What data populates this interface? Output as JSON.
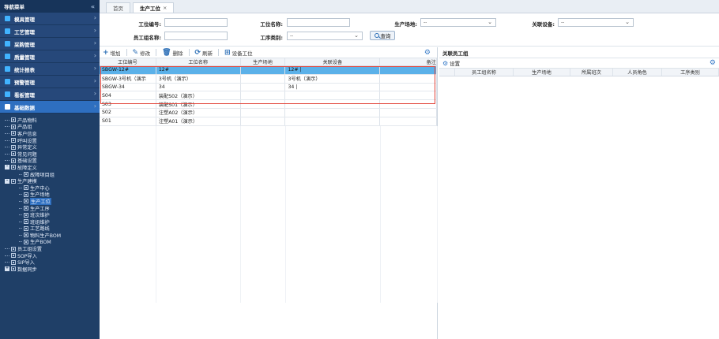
{
  "sidebar": {
    "title": "导航菜单",
    "collapse_glyph": "«",
    "menu": [
      {
        "label": "模具管理",
        "icon": "box-icon",
        "color": "#41b3ff"
      },
      {
        "label": "工艺管理",
        "icon": "gear-icon",
        "color": "#41b3ff"
      },
      {
        "label": "采购管理",
        "icon": "cart-icon",
        "color": "#41b3ff"
      },
      {
        "label": "质量管理",
        "icon": "shield-icon",
        "color": "#41b3ff"
      },
      {
        "label": "统计报表",
        "icon": "chart-icon",
        "color": "#41b3ff"
      },
      {
        "label": "预警管理",
        "icon": "alert-icon",
        "color": "#41b3ff"
      },
      {
        "label": "看板管理",
        "icon": "board-icon",
        "color": "#41b3ff"
      },
      {
        "label": "基础数据",
        "icon": "database-icon",
        "color": "#ffffff"
      }
    ],
    "tree": [
      {
        "label": "产品物料",
        "level": 1
      },
      {
        "label": "产品组",
        "level": 1
      },
      {
        "label": "客户信息",
        "level": 1
      },
      {
        "label": "呼叫设置",
        "level": 1
      },
      {
        "label": "异常定义",
        "level": 1
      },
      {
        "label": "常见问题",
        "level": 1
      },
      {
        "label": "基础设置",
        "level": 1
      },
      {
        "label": "故障定义",
        "level": 1,
        "toggle": "-"
      },
      {
        "label": "故障项目组",
        "level": 2
      },
      {
        "label": "生产建模",
        "level": 1,
        "toggle": "-"
      },
      {
        "label": "生产中心",
        "level": 2
      },
      {
        "label": "生产场地",
        "level": 2
      },
      {
        "label": "生产工位",
        "level": 2,
        "selected": true
      },
      {
        "label": "生产工序",
        "level": 2
      },
      {
        "label": "班次维护",
        "level": 2
      },
      {
        "label": "班组维护",
        "level": 2
      },
      {
        "label": "工艺路线",
        "level": 2
      },
      {
        "label": "物料生产BOM",
        "level": 2
      },
      {
        "label": "生产BOM",
        "level": 2
      },
      {
        "label": "员工组设置",
        "level": 1
      },
      {
        "label": "SOP导入",
        "level": 1
      },
      {
        "label": "SIP导入",
        "level": 1
      },
      {
        "label": "数据同步",
        "level": 1,
        "toggle": "+"
      }
    ]
  },
  "tabs": [
    {
      "label": "首页",
      "active": false
    },
    {
      "label": "生产工位",
      "active": true,
      "close": "×"
    }
  ],
  "filters": {
    "station_no_label": "工位编号:",
    "station_name_label": "工位名称:",
    "site_label": "生产场地:",
    "site_value": "--",
    "equipment_label": "关联设备:",
    "equipment_value": "--",
    "group_name_label": "员工组名称:",
    "process_type_label": "工序类别:",
    "process_type_value": "--",
    "query_label": "查询"
  },
  "toolbar": {
    "add": "增加",
    "edit": "修改",
    "delete": "删除",
    "refresh": "刷新",
    "equipment_position": "设备工位"
  },
  "grid": {
    "headers": [
      "工位编号",
      "工位名称",
      "生产场地",
      "关联设备",
      "备注"
    ],
    "rows": [
      {
        "code": "SBGW-12#",
        "name": "12#",
        "site": "",
        "equipment": "12# |",
        "remark": "",
        "selected": true
      },
      {
        "code": "SBGW-3号机（演示",
        "name": "3号机（演示）",
        "site": "",
        "equipment": "3号机（演示）",
        "remark": ""
      },
      {
        "code": "SBGW-34",
        "name": "34",
        "site": "",
        "equipment": "34 |",
        "remark": ""
      },
      {
        "code": "S04",
        "name": "装配S02（演示）",
        "site": "",
        "equipment": "",
        "remark": ""
      },
      {
        "code": "S03",
        "name": "装配S01（演示）",
        "site": "",
        "equipment": "",
        "remark": ""
      },
      {
        "code": "S02",
        "name": "注塑A02（演示）",
        "site": "",
        "equipment": "",
        "remark": ""
      },
      {
        "code": "S01",
        "name": "注塑A01（演示）",
        "site": "",
        "equipment": "",
        "remark": ""
      }
    ]
  },
  "right_panel": {
    "title": "关联员工组",
    "settings_label": "设置",
    "headers": [
      "员工组名称",
      "生产场地",
      "所属班次",
      "人员角色",
      "工序类别"
    ]
  }
}
